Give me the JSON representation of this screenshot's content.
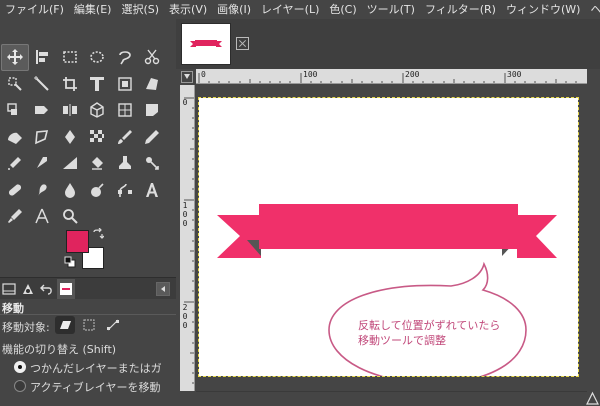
{
  "menu": [
    "ファイル(F)",
    "編集(E)",
    "選択(S)",
    "表示(V)",
    "画像(I)",
    "レイヤー(L)",
    "色(C)",
    "ツール(T)",
    "フィルター(R)",
    "ウィンドウ(W)",
    "ヘルプ(H)"
  ],
  "tools": [
    "move-icon",
    "align-icon",
    "free-select-icon",
    "rect-select-icon",
    "lasso-icon",
    "scissors-icon",
    "fuzzy-select-icon",
    "fuzzy-select-icon",
    "foreground-select-icon",
    "crop-icon",
    "unified-transform-icon",
    "handle-transform-icon",
    "rotate-icon",
    "scale-icon",
    "flip-icon",
    "perspective-icon",
    "3d-transform-icon",
    "cage-icon",
    "warp-icon",
    "shear-icon",
    "bucket-fill-icon",
    "gradient-icon",
    "paintbrush-icon",
    "pencil-icon",
    "airbrush-icon",
    "ink-icon",
    "mypaint-icon",
    "eraser-icon",
    "clone-icon",
    "heal-icon",
    "smudge-icon",
    "blur-icon",
    "dodge-icon",
    "path-icon",
    "text-icon",
    "text-icon-alt",
    "color-picker-icon",
    "measure-icon",
    "zoom-icon"
  ],
  "colors": {
    "foreground": "#e0245e",
    "background": "#ffffff",
    "ribbon": "#f0306a",
    "ribbon_fold": "#555555",
    "bubble_outline": "#c85a86",
    "bubble_text": "#c1487a"
  },
  "tool_options": {
    "title": "移動",
    "move_target_label": "移動対象:",
    "toggle_label": "機能の切り替え  (Shift)",
    "option1": "つかんだレイヤーまたはガ",
    "option2": "アクティブレイヤーを移動"
  },
  "ruler": {
    "h": [
      "0",
      "100",
      "200",
      "300"
    ],
    "v1": [
      "0"
    ],
    "v2": [
      "1",
      "0",
      "0"
    ],
    "v3": [
      "2",
      "0",
      "0"
    ]
  },
  "annotation": {
    "line1": "反転して位置がずれていたら",
    "line2": "移動ツールで調整"
  }
}
